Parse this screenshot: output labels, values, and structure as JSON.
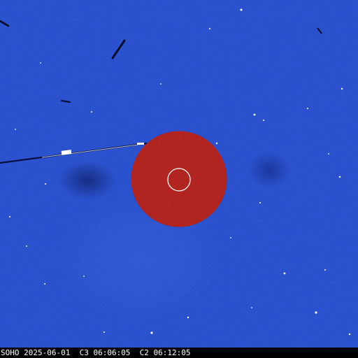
{
  "image": {
    "caption": "SOHO 2025-06-01  C3 06:06:05  C2 06:12:05",
    "colors": {
      "background_blue": "#1f46c8",
      "occulter_red": "#a01010",
      "sun_outline": "#ffffff",
      "caption_bar": "#000000",
      "caption_text": "#ffffff"
    }
  }
}
